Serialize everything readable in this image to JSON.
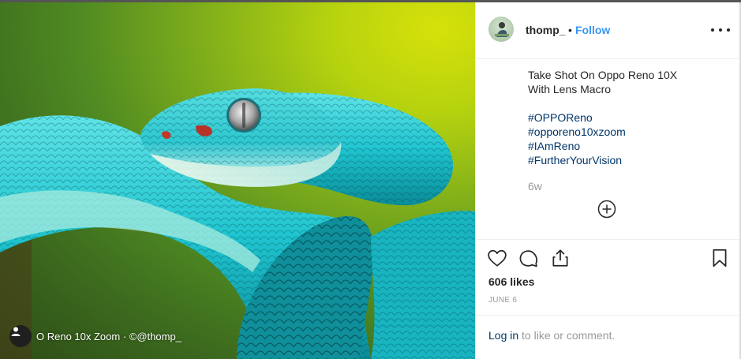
{
  "post": {
    "username": "thomp_",
    "separator": "•",
    "follow_label": "Follow",
    "caption_lines": [
      "Take Shot On Oppo Reno 10X",
      "With Lens Macro"
    ],
    "hashtags": [
      "#OPPOReno",
      "#opporeno10xzoom",
      "#IAmReno",
      "#FurtherYourVision"
    ],
    "time_ago": "6w",
    "likes": "606 likes",
    "date": "JUNE 6",
    "login_link": "Log in",
    "login_suffix": " to like or comment."
  },
  "photo": {
    "credit": "O Reno 10x Zoom · ©@thomp_"
  },
  "icons": {
    "more": "more-options-icon",
    "load_more": "plus-circle-icon",
    "like": "heart-icon",
    "comment": "comment-icon",
    "share": "share-icon",
    "save": "bookmark-icon",
    "credit_avatar": "user-icon"
  },
  "colors": {
    "link": "#3897f0",
    "hashtag": "#003569",
    "muted": "#999999",
    "text": "#262626"
  }
}
